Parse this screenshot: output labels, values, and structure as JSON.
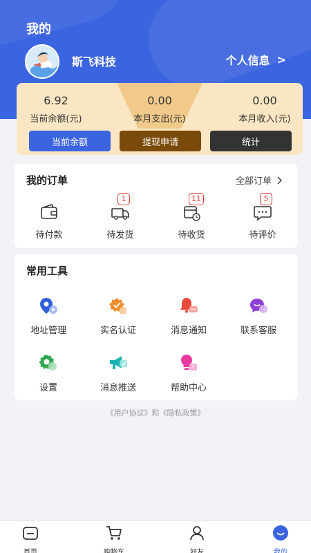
{
  "header": {
    "title": "我的",
    "username": "斯飞科技",
    "profile_label": "个人信息",
    "profile_arrow": ">"
  },
  "finance": {
    "balance": {
      "value": "6.92",
      "label": "当前余额(元)"
    },
    "expense": {
      "value": "0.00",
      "label": "本月支出(元)"
    },
    "income": {
      "value": "0.00",
      "label": "本月收入(元)"
    },
    "buttons": {
      "balance": "当前余额",
      "withdraw": "提现申请",
      "stats": "统计"
    }
  },
  "orders": {
    "title": "我的订单",
    "all_label": "全部订单",
    "items": [
      {
        "label": "待付款",
        "icon": "wallet-icon",
        "badge": ""
      },
      {
        "label": "待发货",
        "icon": "truck-icon",
        "badge": "1"
      },
      {
        "label": "待收货",
        "icon": "package-clock-icon",
        "badge": "11"
      },
      {
        "label": "待评价",
        "icon": "comment-icon",
        "badge": "5"
      }
    ]
  },
  "tools": {
    "title": "常用工具",
    "items": [
      {
        "label": "地址管理",
        "icon": "location-pin-icon"
      },
      {
        "label": "实名认证",
        "icon": "verified-shield-icon"
      },
      {
        "label": "消息通知",
        "icon": "bell-icon"
      },
      {
        "label": "联系客服",
        "icon": "chat-bubble-icon"
      },
      {
        "label": "设置",
        "icon": "gear-icon"
      },
      {
        "label": "消息推送",
        "icon": "megaphone-icon"
      },
      {
        "label": "帮助中心",
        "icon": "lightbulb-icon"
      }
    ]
  },
  "agreement": {
    "text": "《用户协议》和《隐私政策》"
  },
  "tabbar": {
    "items": [
      {
        "label": "首页",
        "icon": "home-icon"
      },
      {
        "label": "购物车",
        "icon": "cart-icon"
      },
      {
        "label": "好友",
        "icon": "friends-icon"
      },
      {
        "label": "我的",
        "icon": "profile-icon"
      }
    ],
    "active": "我的"
  },
  "colors": {
    "primary": "#3b64e0",
    "card_bg": "#fbe6c3",
    "withdraw_btn": "#7a4a0a",
    "stats_btn": "#333333",
    "badge": "#e0392f"
  }
}
